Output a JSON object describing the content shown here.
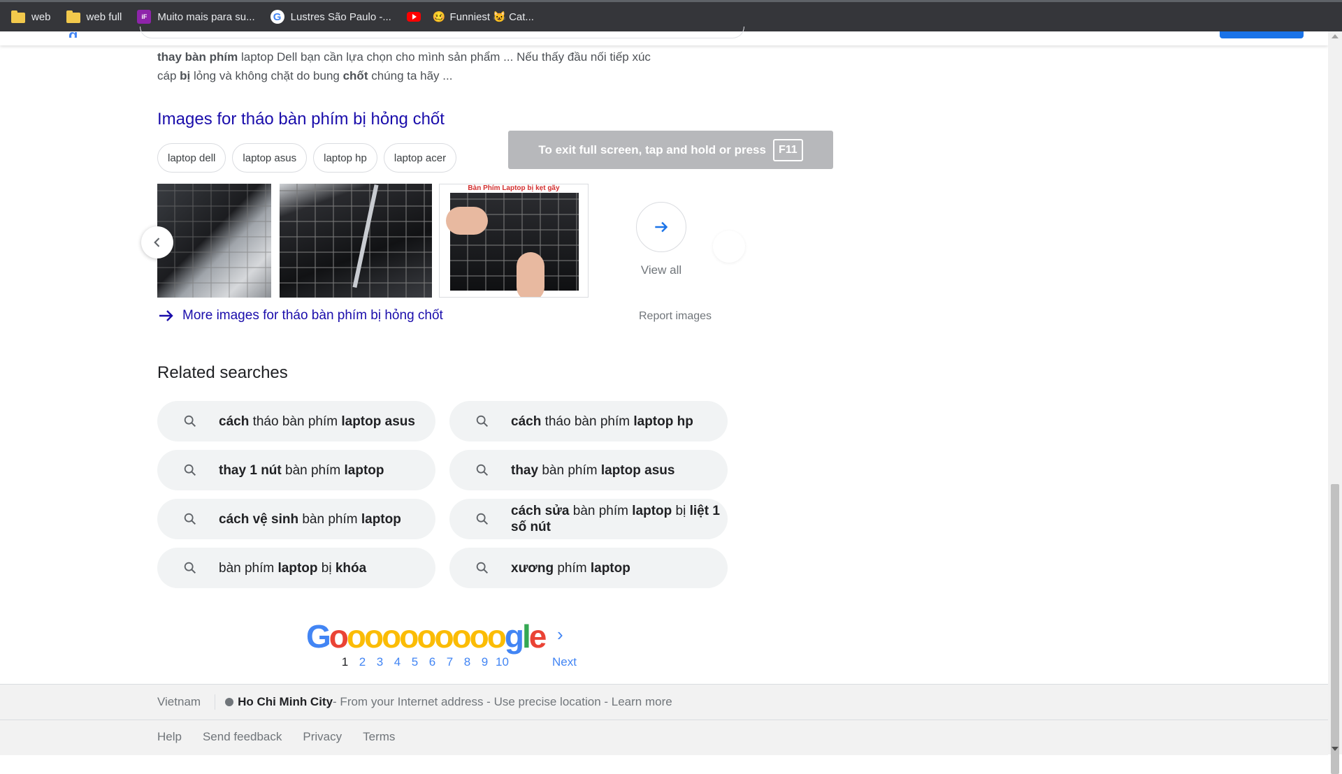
{
  "bookmarks": [
    {
      "label": "web",
      "icon": "folder-icon"
    },
    {
      "label": "web full",
      "icon": "folder-icon"
    },
    {
      "label": "Muito mais para su...",
      "icon": "ifood-icon"
    },
    {
      "label": "Lustres São Paulo -...",
      "icon": "google-icon"
    },
    {
      "label": "",
      "icon": "youtube-icon"
    },
    {
      "label": "Funniest 😺 Cat...",
      "icon": "emoji-icon"
    }
  ],
  "snippet": {
    "line1_b1": "thay bàn phím",
    "line1_rest": " laptop Dell bạn cần lựa chọn cho mình sản phẩm ... Nếu thấy đầu nối tiếp xúc",
    "line2_pre": "cáp ",
    "line2_b1": "bị",
    "line2_mid": " lỏng và không chặt do bung ",
    "line2_b2": "chốt",
    "line2_end": " chúng ta hãy ..."
  },
  "images": {
    "title": "Images for tháo bàn phím bị hỏng chốt",
    "chips": [
      "laptop dell",
      "laptop asus",
      "laptop hp",
      "laptop acer"
    ],
    "thumb3_caption": "Bàn Phím Laptop bị kẹt gãy",
    "view_all": "View all",
    "more_images": "More images for tháo bàn phím bị hỏng chốt",
    "report": "Report images"
  },
  "fullscreen_toast": {
    "text": "To exit full screen, tap and hold or press",
    "key": "F11"
  },
  "related": {
    "title": "Related searches",
    "items": [
      {
        "b1": "cách",
        "t1": " tháo bàn phím ",
        "b2": "laptop asus",
        "t2": ""
      },
      {
        "b1": "cách",
        "t1": " tháo bàn phím ",
        "b2": "laptop hp",
        "t2": ""
      },
      {
        "b1": "thay 1 nút",
        "t1": " bàn phím ",
        "b2": "laptop",
        "t2": ""
      },
      {
        "b1": "thay",
        "t1": " bàn phím ",
        "b2": "laptop asus",
        "t2": ""
      },
      {
        "b1": "cách vệ sinh",
        "t1": " bàn phím ",
        "b2": "laptop",
        "t2": ""
      },
      {
        "b1": "cách sửa",
        "t1": " bàn phím ",
        "b2": "laptop",
        "t2": " bị ",
        "b3": "liệt 1 số nút"
      },
      {
        "b1": "",
        "t1": "bàn phím ",
        "b2": "laptop",
        "t2": " bị ",
        "b3": "khóa"
      },
      {
        "b1": "xương",
        "t1": " phím ",
        "b2": "laptop",
        "t2": ""
      }
    ]
  },
  "pagination": {
    "logo": "Goooooooooogle",
    "pages": [
      "1",
      "2",
      "3",
      "4",
      "5",
      "6",
      "7",
      "8",
      "9",
      "10"
    ],
    "current": "1",
    "next": "Next"
  },
  "footer": {
    "country": "Vietnam",
    "city": "Ho Chi Minh City",
    "location_text": " - From your Internet address - Use precise location - Learn more",
    "links": [
      "Help",
      "Send feedback",
      "Privacy",
      "Terms"
    ]
  },
  "colors": {
    "link": "#1a0dab",
    "accent_blue": "#4285f4",
    "chip_border": "#dadce0",
    "related_bg": "#f1f3f4"
  }
}
